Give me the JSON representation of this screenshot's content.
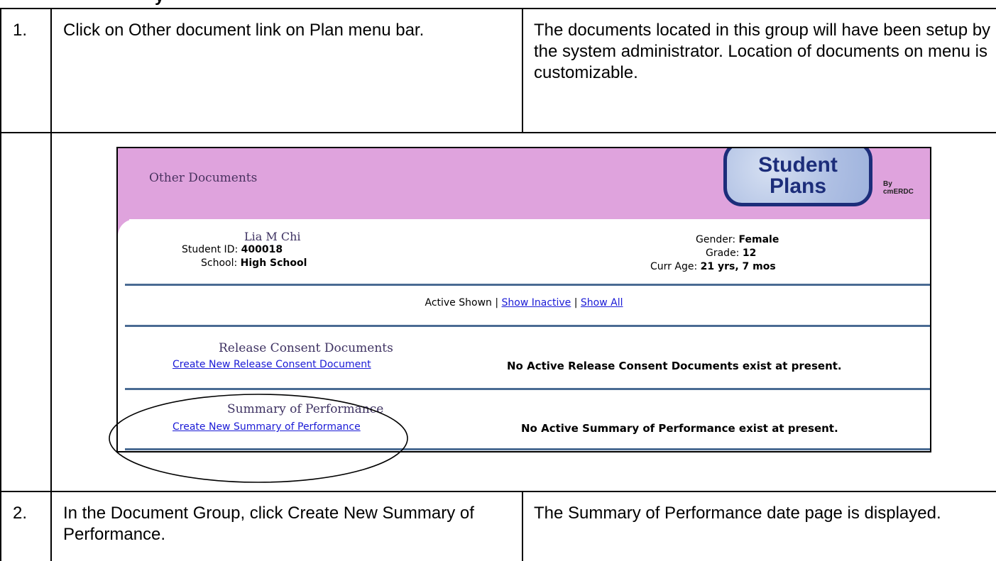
{
  "heading_fragment": "y",
  "rows": [
    {
      "number": "1.",
      "action": "Click on Other document link on Plan menu bar.",
      "result": "The documents located in this group will have been setup by the system administrator. Location of documents on menu is customizable."
    },
    {
      "number": "2.",
      "action": "In the Document Group, click Create New Summary of Performance.",
      "result": "The Summary of Performance date page is displayed."
    }
  ],
  "screenshot": {
    "page_title": "Other Documents",
    "logo_line1": "Student",
    "logo_line2": "Plans",
    "logo_by": "By",
    "logo_vendor": "cmERDC",
    "student": {
      "name": "Lia M Chi",
      "id_label": "Student ID:",
      "id_value": "400018",
      "school_label": "School:",
      "school_value": "High School",
      "gender_label": "Gender:",
      "gender_value": "Female",
      "grade_label": "Grade:",
      "grade_value": "12",
      "age_label": "Curr Age:",
      "age_value": "21 yrs, 7 mos"
    },
    "filter": {
      "active": "Active Shown",
      "sep1": "|",
      "inactive": "Show Inactive",
      "sep2": "|",
      "all": "Show All"
    },
    "groups": [
      {
        "title": "Release Consent Documents",
        "create_link": "Create New Release Consent Document",
        "empty_message": "No Active Release Consent Documents exist at present."
      },
      {
        "title": "Summary of Performance",
        "create_link": "Create New Summary of Performance",
        "empty_message": "No Active Summary of Performance exist at present."
      }
    ]
  }
}
